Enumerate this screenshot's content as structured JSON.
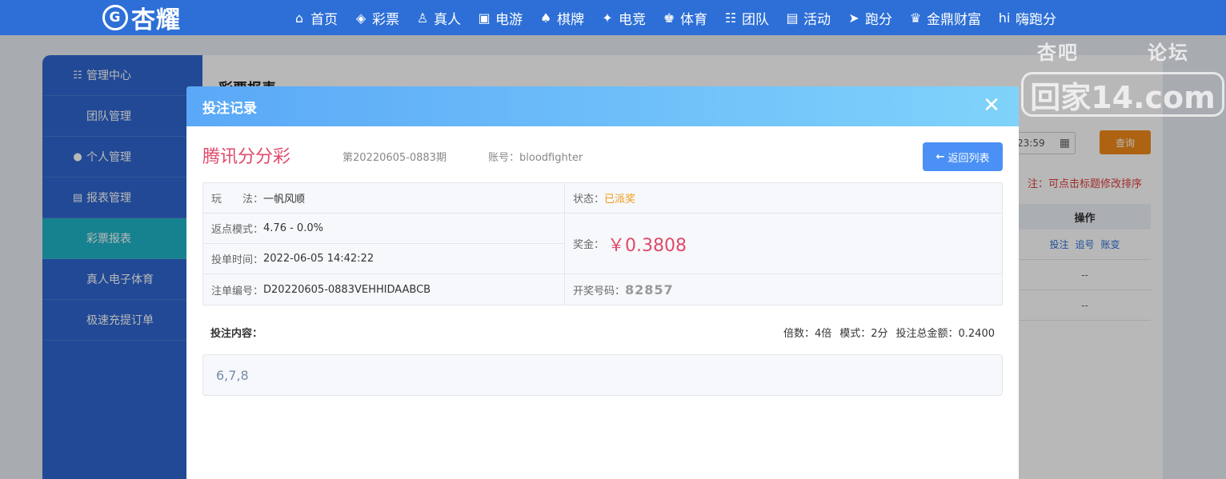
{
  "logo": {
    "mark": "G",
    "text": "杏耀"
  },
  "nav": [
    {
      "icon": "home-icon",
      "glyph": "⌂",
      "label": "首页"
    },
    {
      "icon": "lottery-icon",
      "glyph": "◈",
      "label": "彩票"
    },
    {
      "icon": "live-icon",
      "glyph": "♙",
      "label": "真人"
    },
    {
      "icon": "slot-icon",
      "glyph": "▣",
      "label": "电游"
    },
    {
      "icon": "cards-icon",
      "glyph": "♠",
      "label": "棋牌"
    },
    {
      "icon": "esports-icon",
      "glyph": "✦",
      "label": "电竞"
    },
    {
      "icon": "trophy-icon",
      "glyph": "♚",
      "label": "体育"
    },
    {
      "icon": "team-icon",
      "glyph": "☷",
      "label": "团队"
    },
    {
      "icon": "gift-icon",
      "glyph": "▤",
      "label": "活动"
    },
    {
      "icon": "run-icon",
      "glyph": "➤",
      "label": "跑分"
    },
    {
      "icon": "wealth-icon",
      "glyph": "♛",
      "label": "金鼎财富"
    },
    {
      "icon": "hi-icon",
      "glyph": "hi",
      "label": "嗨跑分"
    }
  ],
  "sidebar": {
    "items": [
      {
        "type": "group",
        "icon": "users-icon",
        "glyph": "☷",
        "label": "管理中心"
      },
      {
        "type": "sub",
        "label": "团队管理"
      },
      {
        "type": "group",
        "icon": "user-icon",
        "glyph": "●",
        "label": "个人管理"
      },
      {
        "type": "group",
        "icon": "report-icon",
        "glyph": "▤",
        "label": "报表管理"
      },
      {
        "type": "sub",
        "label": "彩票报表",
        "active": true
      },
      {
        "type": "sub",
        "label": "真人电子体育"
      },
      {
        "type": "sub",
        "label": "极速充提订单"
      }
    ]
  },
  "main": {
    "title": "彩票报表",
    "date_value": "23:59",
    "query_label": "查询",
    "sort_note": "注：可点击标题修改排序",
    "op_header": "操作",
    "op_links": [
      "投注",
      "追号",
      "账变"
    ],
    "op_empty": "--"
  },
  "watermark": {
    "left": "杏吧",
    "right": "论坛",
    "main": "回家14.com"
  },
  "modal": {
    "title": "投注记录",
    "close": "✕",
    "lottery_name": "腾讯分分彩",
    "issue": "第20220605-0883期",
    "account_label": "账号：",
    "account": "bloodfighter",
    "back_label": "返回列表",
    "play_label": "玩　　法：",
    "play_value": "一帆风顺",
    "status_label": "状态：",
    "status_value": "已派奖",
    "rebate_label": "返点模式：",
    "rebate_value": "4.76 - 0.0%",
    "prize_label": "奖金：",
    "prize_value": "￥0.3808",
    "time_label": "投单时间：",
    "time_value": "2022-06-05 14:42:22",
    "order_label": "注单编号：",
    "order_value": "D20220605-0883VEHHIDAABCB",
    "draw_label": "开奖号码：",
    "draw_value": "82857",
    "content_label": "投注内容：",
    "multiple": "倍数：4倍",
    "mode": "模式：2分",
    "total": "投注总金额：0.2400",
    "content_value": "6,7,8"
  }
}
